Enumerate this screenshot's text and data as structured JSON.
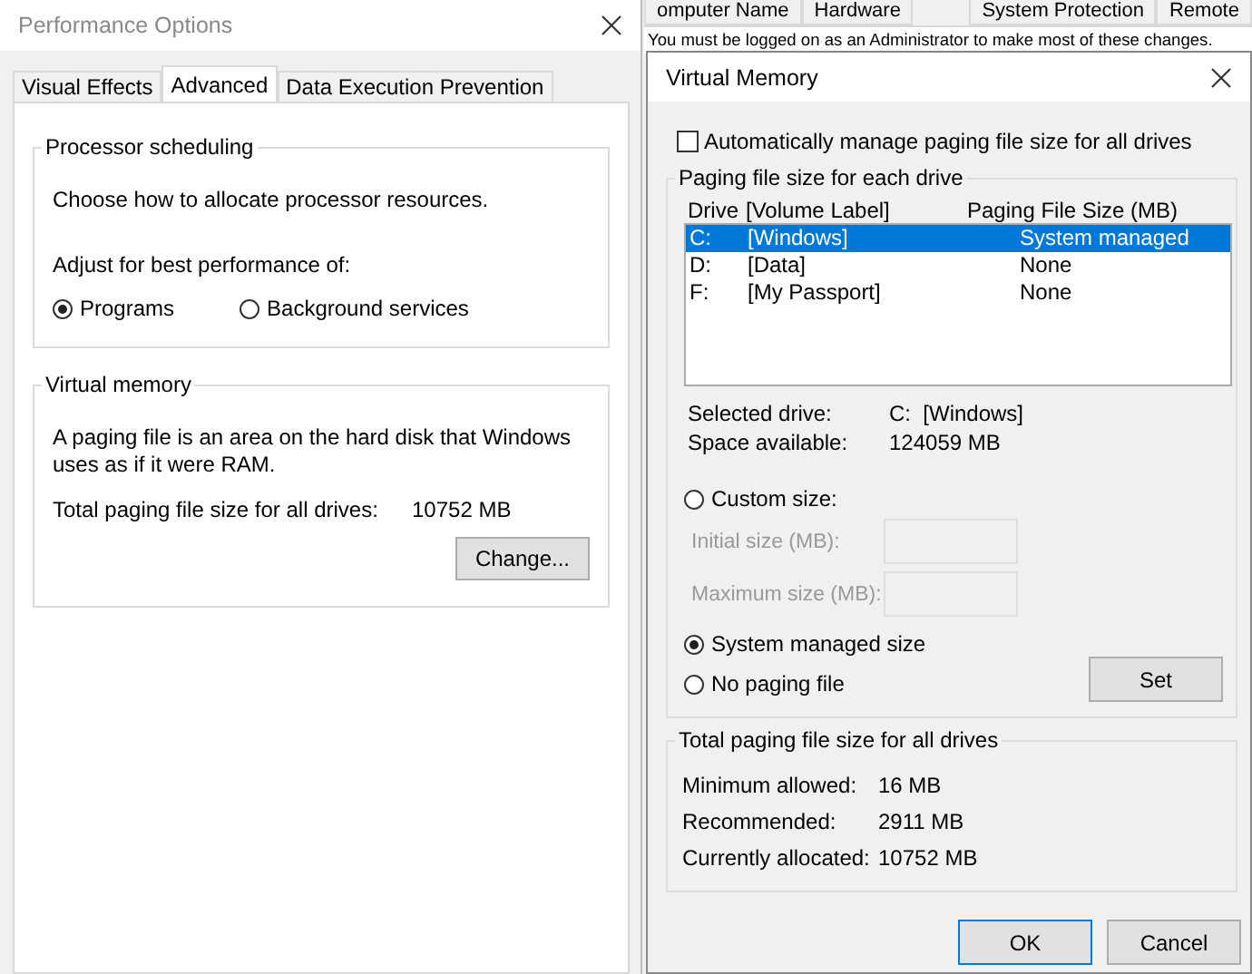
{
  "background_window": {
    "tabs": [
      {
        "label": "omputer Name",
        "selected": false
      },
      {
        "label": "Hardware",
        "selected": false
      },
      {
        "label": "System Protection",
        "selected": false
      },
      {
        "label": "Remote",
        "selected": false
      }
    ],
    "notice": "You must be logged on as an Administrator to make most of these changes."
  },
  "performance_options": {
    "title": "Performance Options",
    "tabs": [
      {
        "label": "Visual Effects",
        "selected": false
      },
      {
        "label": "Advanced",
        "selected": true
      },
      {
        "label": "Data Execution Prevention",
        "selected": false
      }
    ],
    "processor_scheduling": {
      "title": "Processor scheduling",
      "description": "Choose how to allocate processor resources.",
      "adjust_label": "Adjust for best performance of:",
      "options": [
        {
          "label": "Programs",
          "selected": true
        },
        {
          "label": "Background services",
          "selected": false
        }
      ]
    },
    "virtual_memory": {
      "title": "Virtual memory",
      "description": "A paging file is an area on the hard disk that Windows uses as if it were RAM.",
      "total_label": "Total paging file size for all drives:",
      "total_value": "10752 MB",
      "button": "Change..."
    }
  },
  "virtual_memory": {
    "title": "Virtual Memory",
    "auto_manage": {
      "label": "Automatically manage paging file size for all drives",
      "checked": false
    },
    "group_title": "Paging file size for each drive",
    "columns": [
      "Drive",
      "[Volume Label]",
      "Paging File Size (MB)"
    ],
    "rows": [
      {
        "drive": "C:",
        "label": "[Windows]",
        "size": "System managed",
        "selected": true
      },
      {
        "drive": "D:",
        "label": "[Data]",
        "size": "None",
        "selected": false
      },
      {
        "drive": "F:",
        "label": "[My Passport]",
        "size": "None",
        "selected": false
      }
    ],
    "info": [
      {
        "label": "Selected drive:",
        "value": "C:  [Windows]"
      },
      {
        "label": "Space available:",
        "value": "124059 MB"
      }
    ],
    "size_options": [
      {
        "label": "Custom size:",
        "selected": false,
        "fields": [
          {
            "label": "Initial size (MB):",
            "disabled": true
          },
          {
            "label": "Maximum size (MB):",
            "disabled": true
          }
        ]
      },
      {
        "label": "System managed size",
        "selected": true
      },
      {
        "label": "No paging file",
        "selected": false
      }
    ],
    "set_button": "Set",
    "totals": {
      "title": "Total paging file size for all drives",
      "rows": [
        {
          "label": "Minimum allowed:",
          "value": "16 MB"
        },
        {
          "label": "Recommended:",
          "value": "2911 MB"
        },
        {
          "label": "Currently allocated:",
          "value": "10752 MB"
        }
      ]
    },
    "buttons": [
      "OK",
      "Cancel"
    ]
  }
}
